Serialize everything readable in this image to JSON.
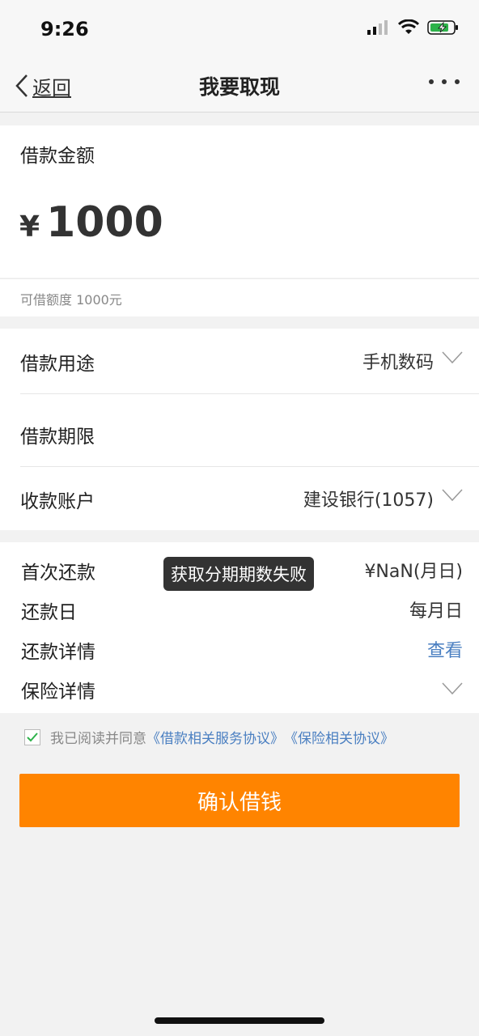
{
  "status_bar": {
    "time": "9:26"
  },
  "nav": {
    "back_label": "返回",
    "title": "我要取现"
  },
  "loan": {
    "amount_label": "借款金额",
    "currency": "¥",
    "amount": "1000",
    "limit_text": "可借额度 1000元"
  },
  "form": {
    "purpose_label": "借款用途",
    "purpose_value": "手机数码",
    "term_label": "借款期限",
    "account_label": "收款账户",
    "account_value": "建设银行(1057)"
  },
  "repay": {
    "first_label": "首次还款",
    "first_value": "¥NaN(月日)",
    "day_label": "还款日",
    "day_value": "每月日",
    "detail_label": "还款详情",
    "detail_link": "查看",
    "insurance_label": "保险详情"
  },
  "toast": {
    "message": "获取分期期数失败"
  },
  "agreement": {
    "prefix": "我已阅读并同意",
    "link1": "《借款相关服务协议》",
    "link2": "《保险相关协议》"
  },
  "confirm_button": "确认借钱",
  "colors": {
    "accent": "#ff8400",
    "link": "#4a7fc1",
    "check": "#2db24a"
  }
}
